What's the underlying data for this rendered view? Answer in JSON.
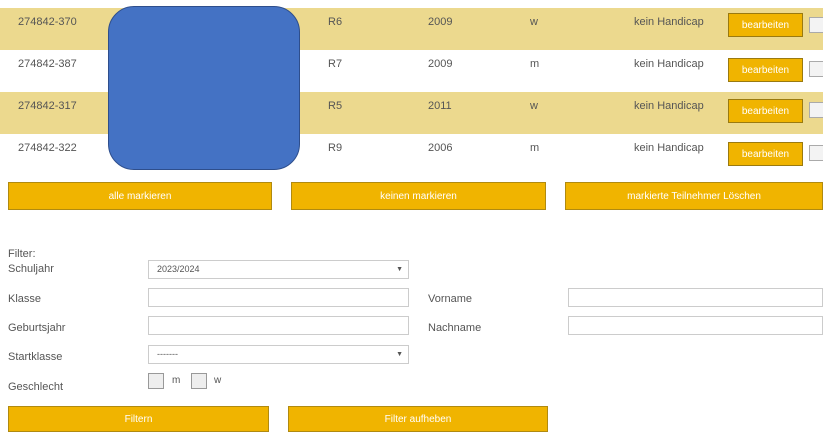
{
  "table": {
    "edit_label": "bearbeiten",
    "rows": [
      {
        "id": "274842-370",
        "klasse": "R6",
        "jahr": "2009",
        "geschlecht": "w",
        "handicap": "kein Handicap"
      },
      {
        "id": "274842-387",
        "klasse": "R7",
        "jahr": "2009",
        "geschlecht": "m",
        "handicap": "kein Handicap"
      },
      {
        "id": "274842-317",
        "klasse": "R5",
        "jahr": "2011",
        "geschlecht": "w",
        "handicap": "kein Handicap"
      },
      {
        "id": "274842-322",
        "klasse": "R9",
        "jahr": "2006",
        "geschlecht": "m",
        "handicap": "kein Handicap"
      }
    ]
  },
  "actions": {
    "mark_all": "alle markieren",
    "mark_none": "keinen markieren",
    "delete_marked": "markierte Teilnehmer Löschen"
  },
  "filter": {
    "heading": "Filter:",
    "schuljahr_label": "Schuljahr",
    "schuljahr_value": "2023/2024",
    "klasse_label": "Klasse",
    "vorname_label": "Vorname",
    "geburtsjahr_label": "Geburtsjahr",
    "nachname_label": "Nachname",
    "startklasse_label": "Startklasse",
    "startklasse_value": "-------",
    "geschlecht_label": "Geschlecht",
    "option_m": "m",
    "option_w": "w",
    "filter_button": "Filtern",
    "reset_button": "Filter aufheben"
  },
  "colors": {
    "accent": "#f0b400",
    "row_shade": "#ecd98e",
    "redaction": "#4472c4"
  }
}
